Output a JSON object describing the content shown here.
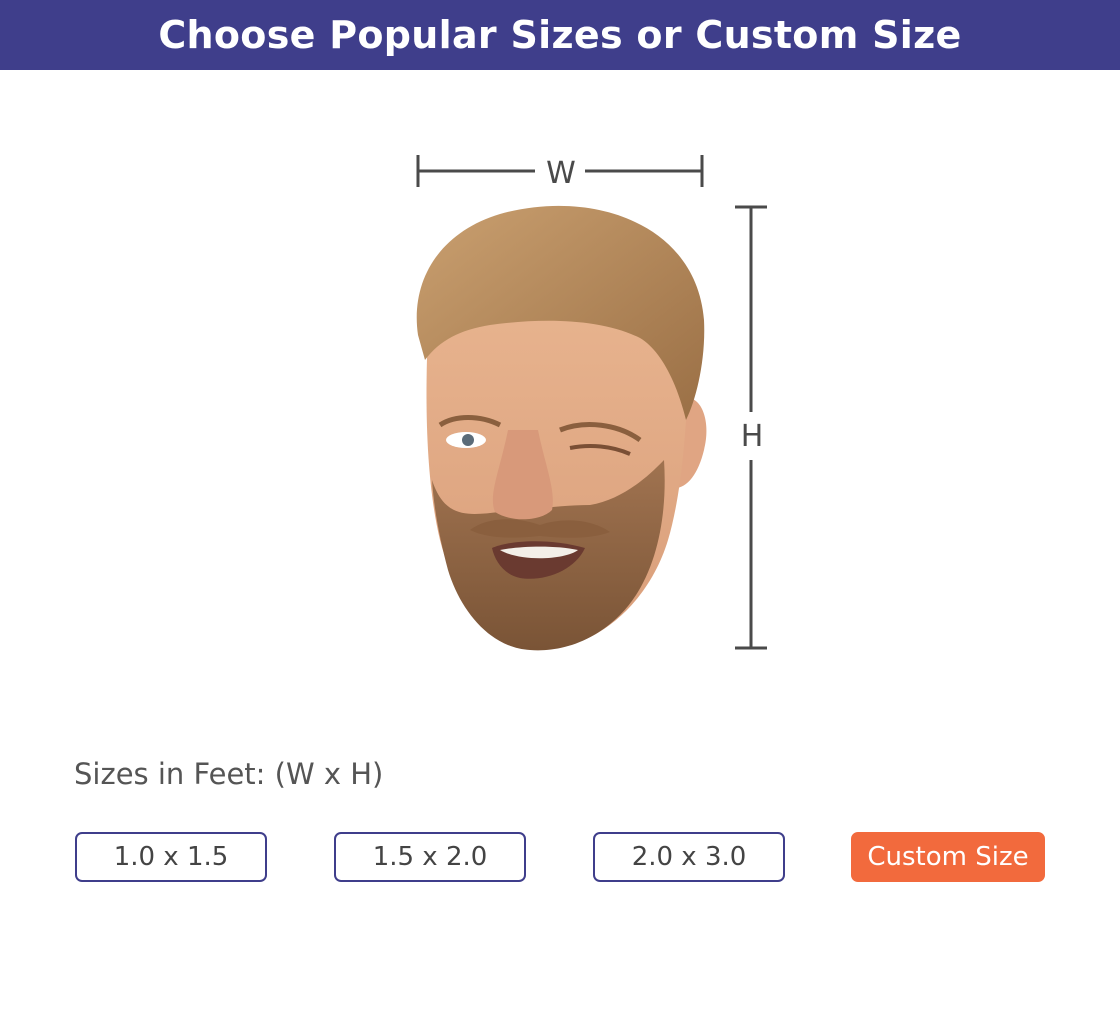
{
  "header": {
    "title": "Choose Popular Sizes or Custom Size"
  },
  "diagram": {
    "width_label": "W",
    "height_label": "H",
    "image_subject": "face-cutout-bearded-man-winking"
  },
  "sizes": {
    "label": "Sizes in Feet: (W x H)",
    "options": [
      "1.0 x 1.5",
      "1.5 x 2.0",
      "2.0 x 3.0"
    ],
    "custom_label": "Custom Size"
  },
  "colors": {
    "banner": "#3f3e8b",
    "button_border": "#3f3e8b",
    "custom_button": "#f26a3d",
    "dimension_lines": "#4a4a4a"
  }
}
